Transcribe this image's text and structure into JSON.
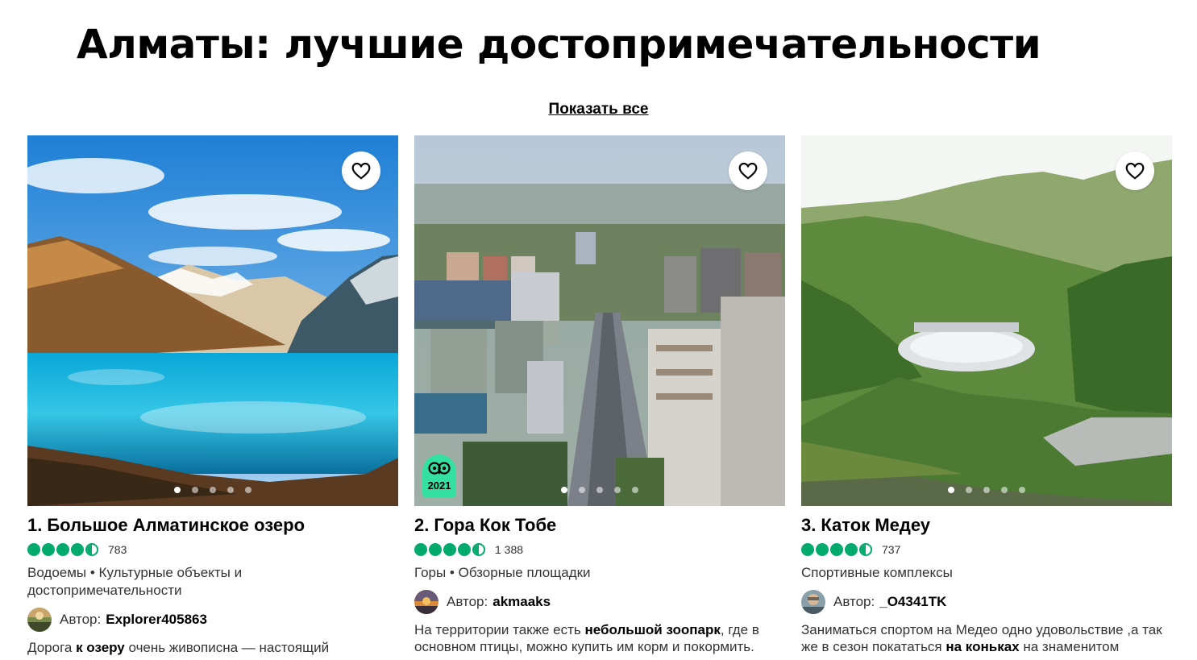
{
  "page": {
    "title": "Алматы: лучшие достопримечательности",
    "show_all": "Показать все"
  },
  "icons": {
    "save": "heart-icon",
    "award": "travelers-choice-owl-icon"
  },
  "colors": {
    "rating_green": "#00aa6c",
    "award_green": "#34e0a1",
    "text": "#000000",
    "secondary_text": "#333333"
  },
  "cards": [
    {
      "rank": "1.",
      "name": "Большое Алматинское озеро",
      "rating": 4.5,
      "review_count": "783",
      "categories": "Водоемы • Культурные объекты и достопримечательности",
      "author_label": "Автор:",
      "author": "Explorer405863",
      "review_parts": [
        "Дорога ",
        "к озеру",
        " очень живописна — настоящий"
      ],
      "photo_count": 5,
      "active_photo": 1
    },
    {
      "rank": "2.",
      "name": "Гора Кок Тобе",
      "rating": 4.5,
      "review_count": "1 388",
      "categories": "Горы • Обзорные площадки",
      "author_label": "Автор:",
      "author": "akmaaks",
      "review_parts": [
        "На территории также есть ",
        "небольшой зоопарк",
        ", где в основном птицы, можно купить им корм и покормить."
      ],
      "award_year": "2021",
      "photo_count": 5,
      "active_photo": 1
    },
    {
      "rank": "3.",
      "name": "Каток Медеу",
      "rating": 4.5,
      "review_count": "737",
      "categories": "Спортивные комплексы",
      "author_label": "Автор:",
      "author": "_O4341TK",
      "review_parts": [
        "Заниматься спортом на Медео одно удовольствие ,а так же в сезон покататься ",
        "на коньках",
        " на знаменитом"
      ],
      "photo_count": 5,
      "active_photo": 1
    }
  ]
}
